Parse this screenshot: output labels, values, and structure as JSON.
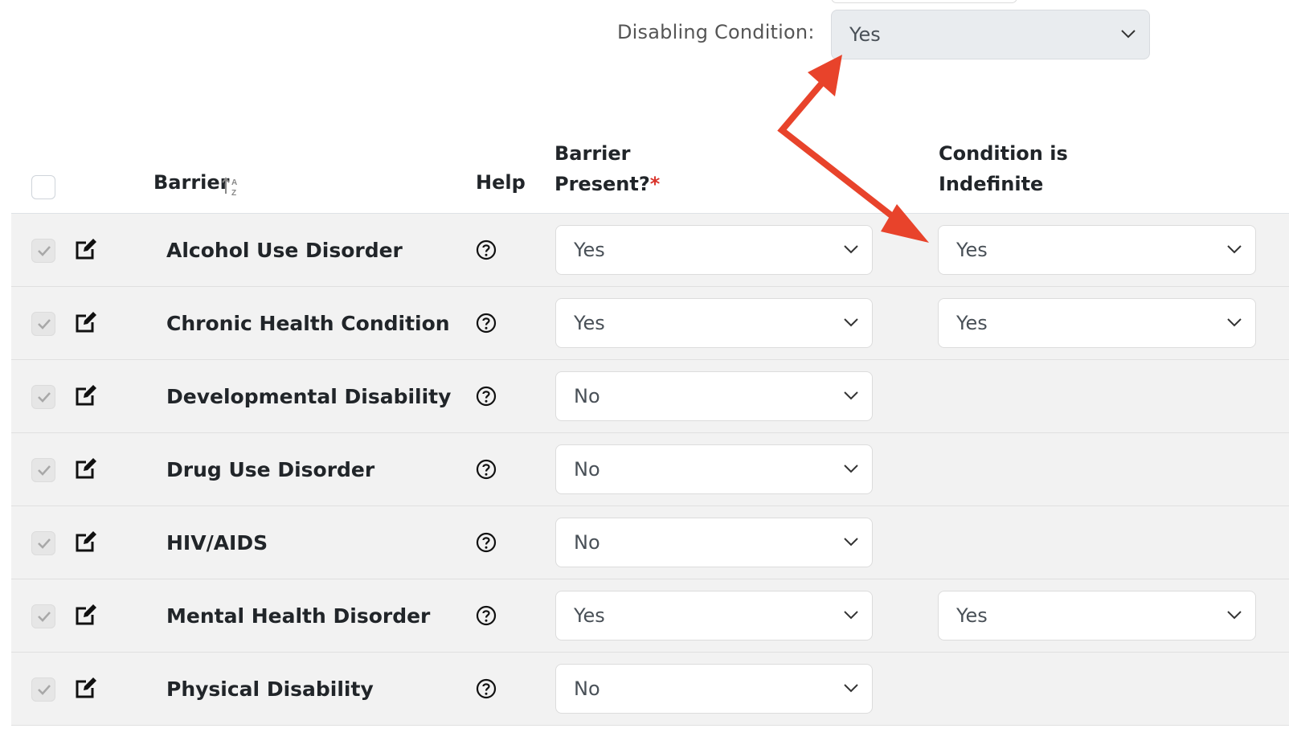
{
  "disabling_condition": {
    "label": "Disabling Condition:",
    "value": "Yes"
  },
  "table": {
    "headers": {
      "barrier": "Barrier",
      "help": "Help",
      "barrier_present_line1": "Barrier",
      "barrier_present_line2": "Present?",
      "required_mark": "*",
      "condition_line1": "Condition is",
      "condition_line2": "Indefinite"
    },
    "rows": [
      {
        "name": "Alcohol Use Disorder",
        "present": "Yes",
        "indefinite": "Yes"
      },
      {
        "name": "Chronic Health Condition",
        "present": "Yes",
        "indefinite": "Yes"
      },
      {
        "name": "Developmental Disability",
        "present": "No",
        "indefinite": null
      },
      {
        "name": "Drug Use Disorder",
        "present": "No",
        "indefinite": null
      },
      {
        "name": "HIV/AIDS",
        "present": "No",
        "indefinite": null
      },
      {
        "name": "Mental Health Disorder",
        "present": "Yes",
        "indefinite": "Yes"
      },
      {
        "name": "Physical Disability",
        "present": "No",
        "indefinite": null
      }
    ]
  },
  "colors": {
    "annotation_arrow": "#e8432b",
    "required": "#d9342b",
    "row_bg": "#f2f2f2"
  }
}
